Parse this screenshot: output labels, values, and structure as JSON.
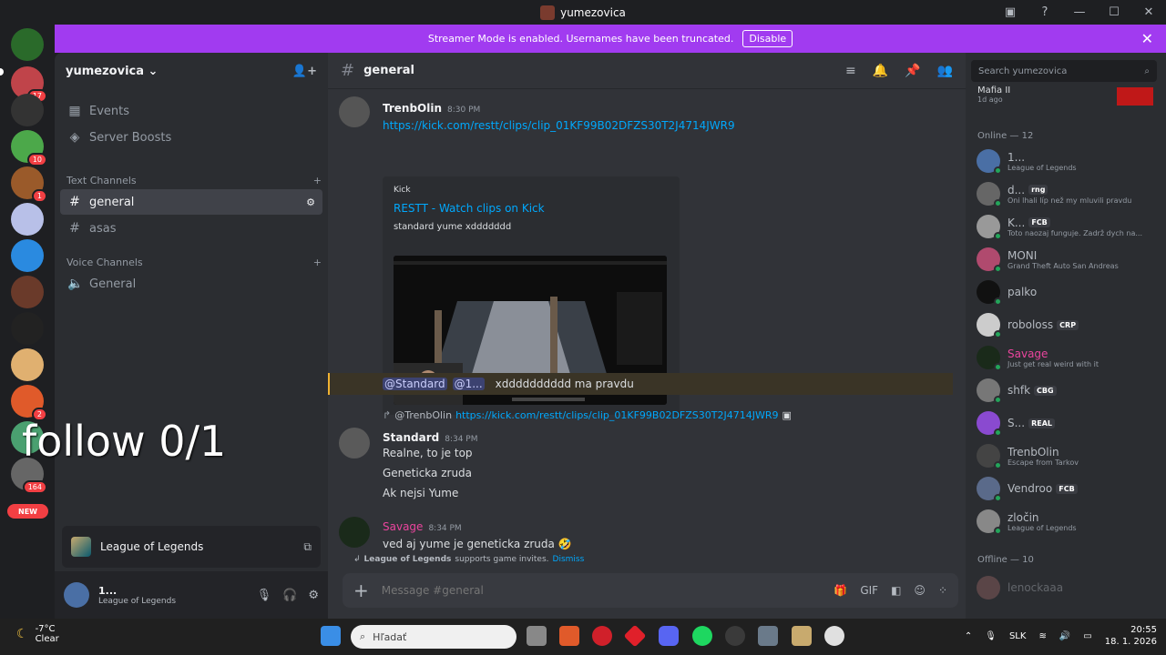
{
  "window": {
    "title": "yumezovica"
  },
  "banner": {
    "text": "Streamer Mode is enabled. Usernames have been truncated.",
    "disable_label": "Disable"
  },
  "guild_badges": [
    "17",
    "10",
    "1",
    "2",
    "164"
  ],
  "new_badge": "NEW",
  "server": {
    "name": "yumezovica"
  },
  "sidebar": {
    "top_items": [
      {
        "label": "Events",
        "icon": "calendar-icon"
      },
      {
        "label": "Server Boosts",
        "icon": "boost-icon"
      }
    ],
    "text_category": "Text Channels",
    "text_channels": [
      "general",
      "asas"
    ],
    "voice_category": "Voice Channels",
    "voice_channels": [
      "General"
    ]
  },
  "activity": {
    "game": "League of Legends"
  },
  "user": {
    "name": "1...",
    "status": "League of Legends"
  },
  "header": {
    "channel": "general"
  },
  "messages": {
    "m1": {
      "author": "TrenbOlin",
      "time": "8:30 PM",
      "link": "https://kick.com/restt/clips/clip_01KF99B02DFZS30T2J4714JWR9"
    },
    "embed": {
      "provider": "Kick",
      "title": "RESTT - Watch clips on Kick",
      "desc": "standard yume xddddddd"
    },
    "mention_row": {
      "m1": "@Standard",
      "m2": "@1...",
      "text": "xdddddddddd ma pravdu"
    },
    "reply": {
      "user": "@TrenbOlin",
      "link": "https://kick.com/restt/clips/clip_01KF99B02DFZS30T2J4714JWR9"
    },
    "m2": {
      "author": "Standard",
      "time": "8:34 PM",
      "lines": [
        "Realne, to je top",
        "Geneticka zruda",
        "Ak nejsi Yume"
      ]
    },
    "m3": {
      "author": "Savage",
      "time": "8:34 PM",
      "text": "ved aj yume je geneticka zruda 🤣"
    },
    "game_invite": {
      "game": "League of Legends",
      "text": "supports game invites.",
      "dismiss": "Dismiss"
    }
  },
  "composer": {
    "placeholder": "Message #general"
  },
  "members": {
    "search_placeholder": "Search yumezovica",
    "top_card": {
      "title": "Mafia II",
      "sub": "1d ago"
    },
    "online_header": "Online — 12",
    "online": [
      {
        "name": "1...",
        "status": "League of Legends",
        "color": "#4a6fa5"
      },
      {
        "name": "d...",
        "tag": "rng",
        "status": "Oni lhali líp než my mluvili pravdu",
        "color": "#666"
      },
      {
        "name": "K...",
        "tag": "FCB",
        "status": "Toto naozaj funguje. Zadrž dych na...",
        "color": "#999"
      },
      {
        "name": "MONI",
        "status": "Grand Theft Auto San Andreas",
        "color": "#b04a6e"
      },
      {
        "name": "palko",
        "status": "",
        "color": "#111"
      },
      {
        "name": "roboloss",
        "tag": "CRP",
        "status": "",
        "color": "#ccc"
      },
      {
        "name": "Savage",
        "status": "Just get real weird with it",
        "color": "#1a2a1a",
        "namecolor": "#eb459e"
      },
      {
        "name": "shfk",
        "tag": "CBG",
        "status": "",
        "color": "#777"
      },
      {
        "name": "S...",
        "tag": "REAL",
        "status": "",
        "color": "#8a4ad0"
      },
      {
        "name": "TrenbOlin",
        "status": "Escape from Tarkov",
        "color": "#444"
      },
      {
        "name": "Vendroo",
        "tag": "FCB",
        "status": "",
        "color": "#5a6a8a"
      },
      {
        "name": "zločin",
        "status": "League of Legends",
        "color": "#888"
      }
    ],
    "offline_header": "Offline — 10",
    "offline": [
      {
        "name": "lenockaaa"
      }
    ]
  },
  "taskbar": {
    "temp": "-7°C",
    "weather": "Clear",
    "search": "Hľadať",
    "lang": "SLK",
    "time": "20:55",
    "date": "18. 1. 2026"
  },
  "overlay": {
    "text": "follow 0/1"
  }
}
